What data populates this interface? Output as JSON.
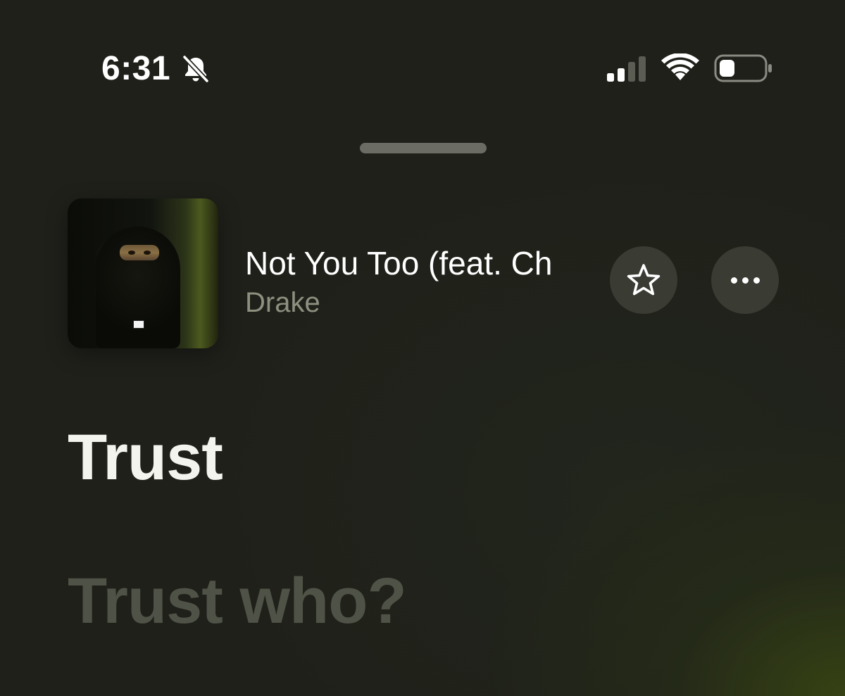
{
  "status_bar": {
    "time": "6:31",
    "icons": [
      "bell-slash-icon",
      "cellular-signal-icon",
      "wifi-icon",
      "battery-icon"
    ],
    "signal_bars_active": 2,
    "signal_bars_total": 4,
    "battery_level": 0.35
  },
  "now_playing": {
    "title": "Not You Too (feat. Ch",
    "artist": "Drake",
    "favorite_icon": "star-icon",
    "more_icon": "ellipsis-icon"
  },
  "lyrics": {
    "current": "Trust",
    "next": "Trust who?"
  },
  "colors": {
    "background": "#1f201a",
    "secondary_text": "#8e907f",
    "button_background": "#3a3b33",
    "dim_lyric": "#4f5246"
  }
}
